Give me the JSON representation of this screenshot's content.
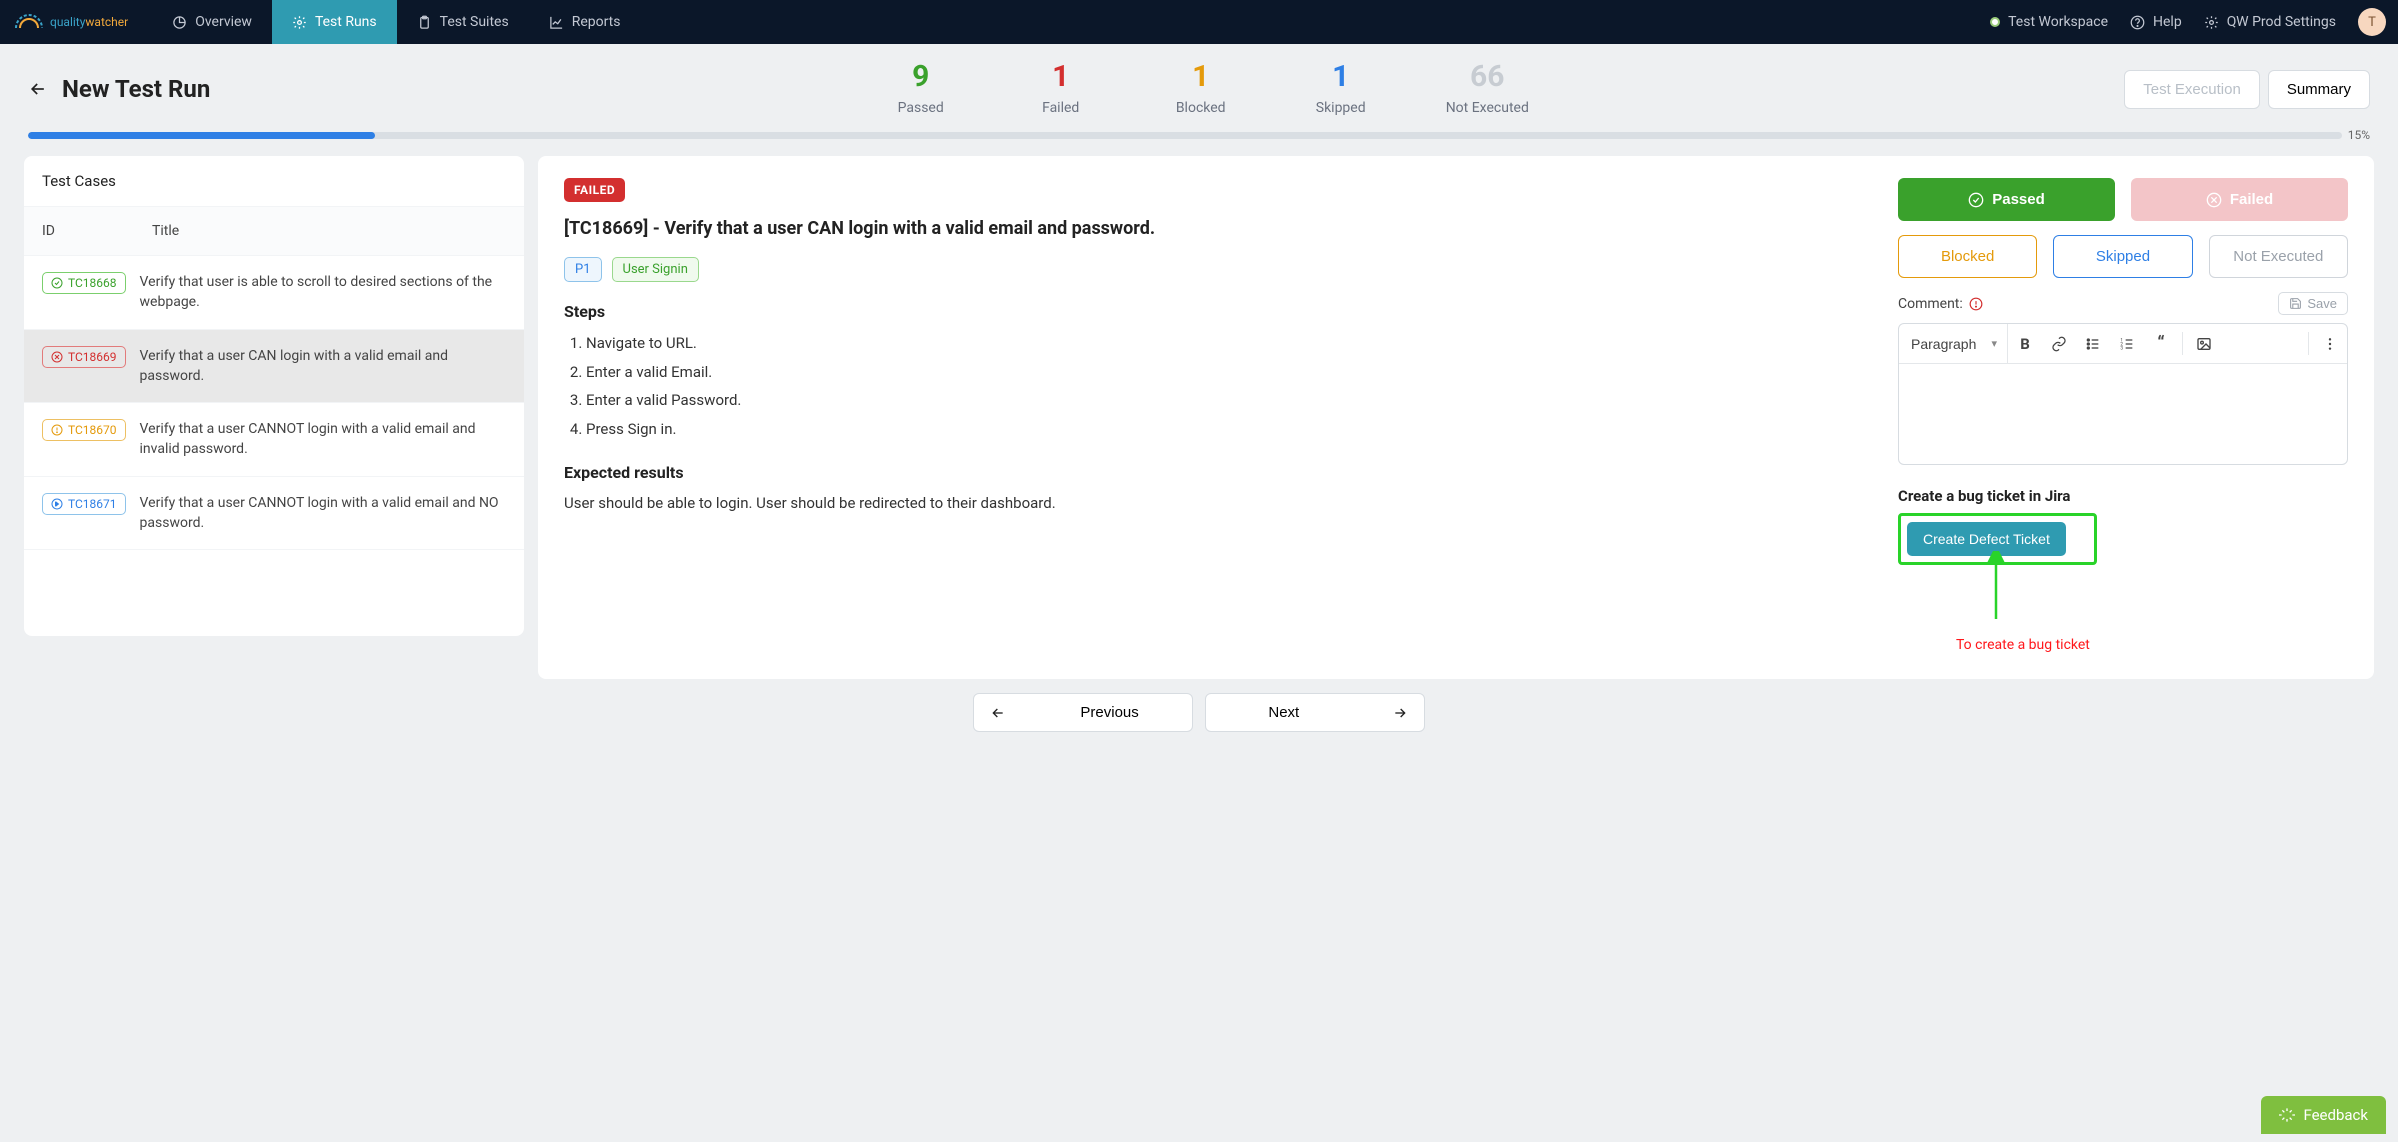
{
  "brand": {
    "name": "qualitywatcher"
  },
  "nav": {
    "tabs": [
      {
        "label": "Overview"
      },
      {
        "label": "Test Runs"
      },
      {
        "label": "Test Suites"
      },
      {
        "label": "Reports"
      }
    ],
    "workspace": "Test Workspace",
    "help": "Help",
    "settings": "QW Prod Settings",
    "avatar_initial": "T"
  },
  "header": {
    "title": "New Test Run",
    "stats": {
      "passed": {
        "value": "9",
        "label": "Passed"
      },
      "failed": {
        "value": "1",
        "label": "Failed"
      },
      "blocked": {
        "value": "1",
        "label": "Blocked"
      },
      "skipped": {
        "value": "1",
        "label": "Skipped"
      },
      "notexec": {
        "value": "66",
        "label": "Not Executed"
      }
    },
    "views": {
      "execution": "Test Execution",
      "summary": "Summary"
    },
    "progress_pct": "15%"
  },
  "test_cases": {
    "title": "Test Cases",
    "col_id": "ID",
    "col_title": "Title",
    "rows": [
      {
        "id": "TC18668",
        "status": "passed",
        "title": "Verify that user is able to scroll to desired sections of the webpage."
      },
      {
        "id": "TC18669",
        "status": "failed",
        "title": "Verify that a user CAN login with a valid email and password."
      },
      {
        "id": "TC18670",
        "status": "blocked",
        "title": "Verify that a user CANNOT login with a valid email and invalid password."
      },
      {
        "id": "TC18671",
        "status": "skipped",
        "title": "Verify that a user CANNOT login with a valid email and NO password."
      }
    ]
  },
  "detail": {
    "status": "FAILED",
    "title": "[TC18669] - Verify that a user CAN login with a valid email and password.",
    "priority": "P1",
    "tag": "User Signin",
    "steps_heading": "Steps",
    "steps": [
      "Navigate to URL.",
      "Enter a valid Email.",
      "Enter a valid Password.",
      "Press Sign in."
    ],
    "expected_heading": "Expected results",
    "expected": "User should be able to login. User should be redirected to their dashboard."
  },
  "actions": {
    "passed": "Passed",
    "failed": "Failed",
    "blocked": "Blocked",
    "skipped": "Skipped",
    "notexec": "Not Executed",
    "comment_label": "Comment:",
    "save": "Save",
    "format_option": "Paragraph",
    "jira_heading": "Create a bug ticket in Jira",
    "jira_button": "Create Defect Ticket",
    "annotation": "To create a bug ticket"
  },
  "pager": {
    "prev": "Previous",
    "next": "Next"
  },
  "feedback": "Feedback"
}
